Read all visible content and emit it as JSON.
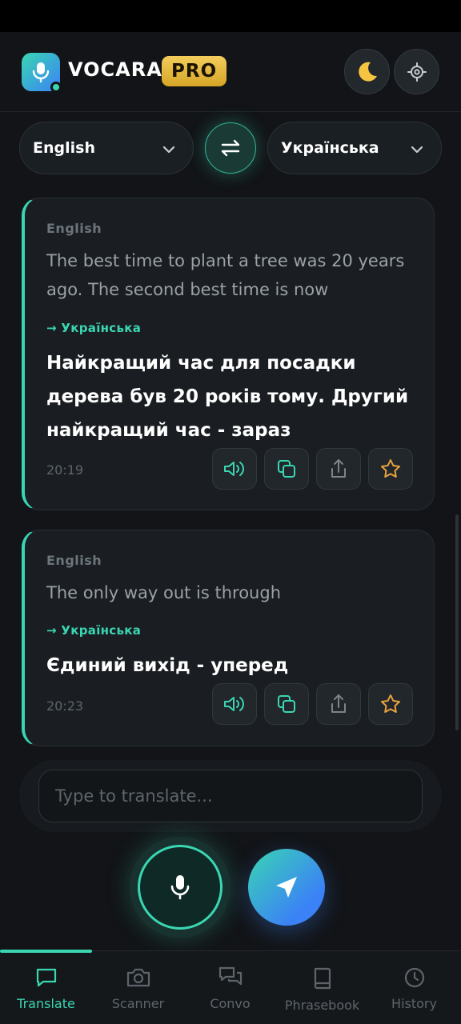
{
  "header": {
    "brand": "VOCARA",
    "badge": "PRO",
    "icons": [
      "mic-icon",
      "moon-icon",
      "settings-icon"
    ]
  },
  "languages": {
    "source": "English",
    "target": "Українська"
  },
  "translations": [
    {
      "source_lang": "English",
      "source_text": "The best time to plant a tree was 20 years ago. The second best time is now",
      "target_lang": "→ Українська",
      "target_text": "Найкращий час для посадки дерева був 20 років тому. Другий найкращий час - зараз",
      "time": "20:19"
    },
    {
      "source_lang": "English",
      "source_text": "The only way out is through",
      "target_lang": "→ Українська",
      "target_text": "Єдиний вихід - уперед",
      "time": "20:23"
    }
  ],
  "input": {
    "placeholder": "Type to translate...",
    "value": ""
  },
  "nav": [
    {
      "label": "Translate",
      "icon": "chat-icon",
      "active": true
    },
    {
      "label": "Scanner",
      "icon": "camera-icon",
      "active": false
    },
    {
      "label": "Convo",
      "icon": "conversation-icon",
      "active": false
    },
    {
      "label": "Phrasebook",
      "icon": "book-icon",
      "active": false
    },
    {
      "label": "History",
      "icon": "clock-icon",
      "active": false
    }
  ],
  "colors": {
    "accent": "#3ad6b2",
    "brand_blue": "#3b82f6",
    "pro_gold": "#e9b93d",
    "star": "#e8a33d",
    "background": "#121417"
  }
}
